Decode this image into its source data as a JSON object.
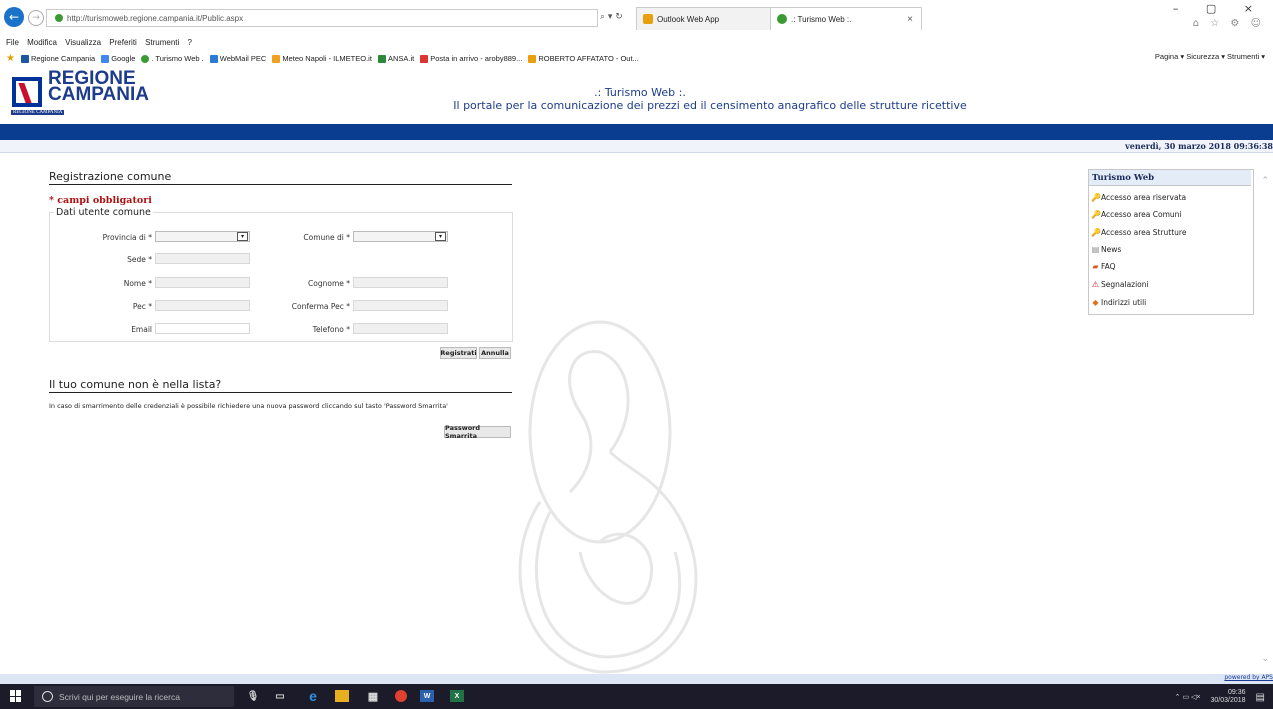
{
  "browser": {
    "url": "http://turismoweb.regione.campania.it/Public.aspx",
    "search_glyph": "⌕ ▾ ↻",
    "tabs": [
      {
        "label": "Outlook Web App"
      },
      {
        "label": ".: Turismo Web :."
      }
    ],
    "tab_close": "×",
    "window_controls": "– ▢ ×",
    "toolbar_icons": "⌂ ☆ ⚙ ☺",
    "menu": [
      "File",
      "Modifica",
      "Visualizza",
      "Preferiti",
      "Strumenti",
      "?"
    ],
    "favorites": [
      {
        "label": "Regione Campania",
        "color": "#1e56a0"
      },
      {
        "label": "Google",
        "color": "#4285f4"
      },
      {
        "label": ". Turismo Web .",
        "color": "#3c9a35"
      },
      {
        "label": "WebMail PEC",
        "color": "#2a7ad6"
      },
      {
        "label": "Meteo Napoli - ILMETEO.it",
        "color": "#f0a020"
      },
      {
        "label": "ANSA.it",
        "color": "#2a8a3a"
      },
      {
        "label": "Posta in arrivo - aroby889...",
        "color": "#d33"
      },
      {
        "label": "ROBERTO AFFATATO - Out...",
        "color": "#e8a010"
      }
    ],
    "command_bar": "Pagina ▾   Sicurezza ▾   Strumenti ▾"
  },
  "header": {
    "logo_line1": "REGIONE",
    "logo_line2": "CAMPANIA",
    "logo_sub": "REGIONE CAMPANIA",
    "title": ".: Turismo Web :.",
    "subtitle": "Il portale per la comunicazione dei prezzi ed il censimento anagrafico delle strutture ricettive",
    "date": "venerdì, 30 marzo 2018 09:36:38"
  },
  "form": {
    "title": "Registrazione comune",
    "required_note": "* campi obbligatori",
    "legend": "Dati utente comune",
    "provincia_label": "Provincia di *",
    "comune_label": "Comune di *",
    "sede_label": "Sede *",
    "nome_label": "Nome *",
    "cognome_label": "Cognome *",
    "pec_label": "Pec *",
    "conferma_pec_label": "Conferma Pec *",
    "email_label": "Email",
    "telefono_label": "Telefono *",
    "dropdown_glyph": "▾",
    "register_button": "Registrati",
    "cancel_button": "Annulla"
  },
  "missing": {
    "title": "Il tuo comune non è nella lista?",
    "text": "In caso di smarrimento delle credenziali è possibile richiedere una nuova password cliccando sul tasto 'Password Smarrita'",
    "button": "Password Smarrita"
  },
  "sidebar": {
    "title": "Turismo Web",
    "items": [
      {
        "label": "Accesso area riservata",
        "icon": "key-icon",
        "glyph": "🔑"
      },
      {
        "label": "Accesso area Comuni",
        "icon": "key-icon",
        "glyph": "🔑"
      },
      {
        "label": "Accesso area Strutture",
        "icon": "key-icon",
        "glyph": "🔑"
      },
      {
        "label": "News",
        "icon": "news-icon",
        "glyph": "▤"
      },
      {
        "label": "FAQ",
        "icon": "faq-icon",
        "glyph": "▰"
      },
      {
        "label": "Segnalazioni",
        "icon": "warning-icon",
        "glyph": "⚠"
      },
      {
        "label": "Indirizzi utili",
        "icon": "book-icon",
        "glyph": "◆"
      }
    ]
  },
  "footer": {
    "powered": "powered by APS"
  },
  "taskbar": {
    "search_placeholder": "Scrivi qui per eseguire la ricerca",
    "time": "09:36",
    "date": "30/03/2018"
  },
  "colors": {
    "brand_blue": "#0a3d8f",
    "header_text": "#1e3c8c",
    "required_red": "#b01010"
  }
}
